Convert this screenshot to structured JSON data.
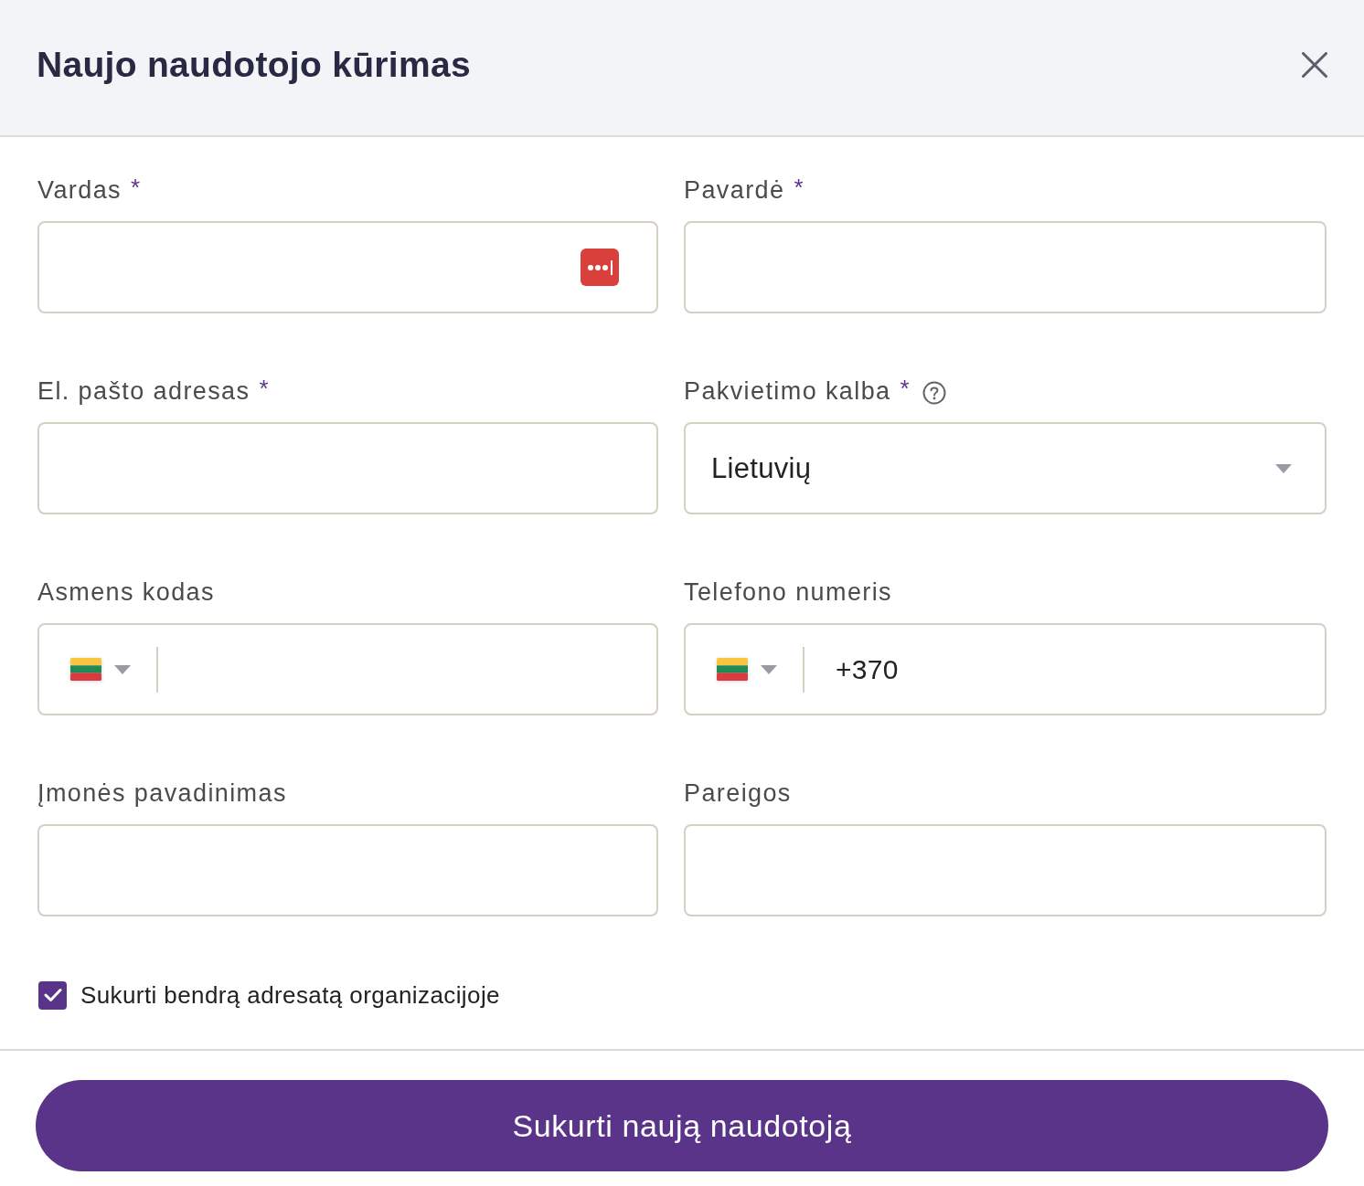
{
  "dialog": {
    "title": "Naujo naudotojo kūrimas"
  },
  "fields": [
    {
      "label": "Vardas",
      "required_mark": "*",
      "help": false,
      "kind": "text",
      "autofill_badge": true
    },
    {
      "label": "Pavardė",
      "required_mark": "*",
      "help": false,
      "kind": "text",
      "autofill_badge": false
    },
    {
      "label": "El. pašto adresas",
      "required_mark": "*",
      "help": false,
      "kind": "text",
      "autofill_badge": false
    },
    {
      "label": "Pakvietimo kalba",
      "required_mark": "*",
      "help": true,
      "kind": "select",
      "value": "Lietuvių",
      "autofill_badge": false
    },
    {
      "label": "Asmens kodas",
      "help": false,
      "kind": "country",
      "autofill_badge": false
    },
    {
      "label": "Telefono numeris",
      "help": false,
      "kind": "country",
      "value": "+370",
      "autofill_badge": false
    },
    {
      "label": "Įmonės pavadinimas",
      "help": false,
      "kind": "text",
      "autofill_badge": false
    },
    {
      "label": "Pareigos",
      "help": false,
      "kind": "text",
      "autofill_badge": false
    }
  ],
  "checkbox": {
    "label": "Sukurti bendrą adresatą organizacijoje",
    "checked": true
  },
  "submit": {
    "label": "Sukurti naują naudotoją"
  }
}
